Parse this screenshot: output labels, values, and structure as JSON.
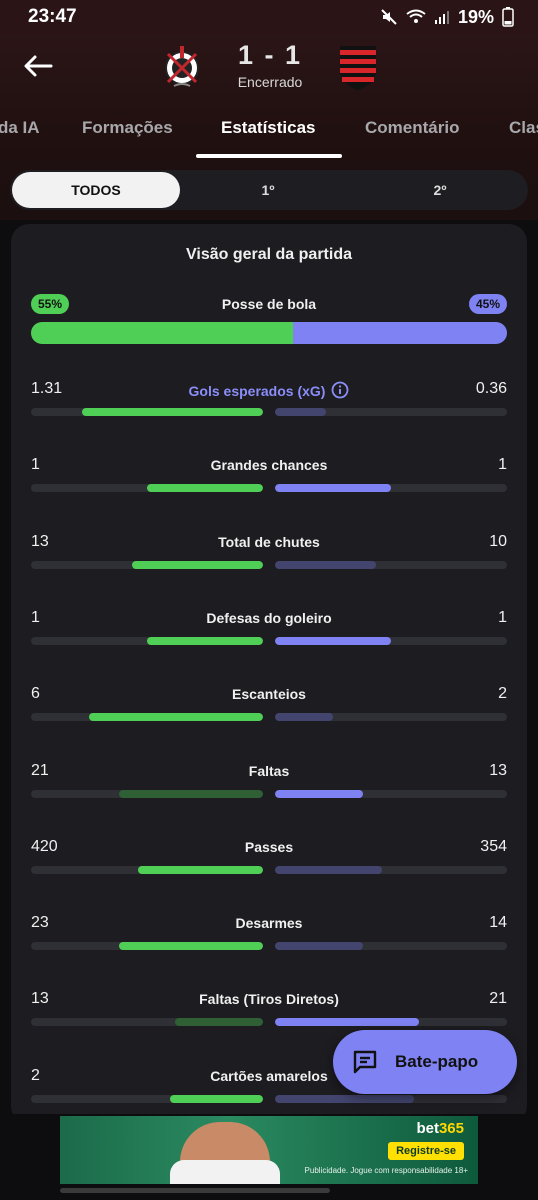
{
  "status_bar": {
    "time": "23:47",
    "battery": "19%"
  },
  "match": {
    "home_score": "1",
    "separator": "-",
    "away_score": "1",
    "status": "Encerrado"
  },
  "tabs": [
    {
      "label": "da IA",
      "active": false
    },
    {
      "label": "Formações",
      "active": false
    },
    {
      "label": "Estatísticas",
      "active": true
    },
    {
      "label": "Comentário",
      "active": false
    },
    {
      "label": "Clas",
      "active": false
    }
  ],
  "periods": [
    {
      "label": "TODOS",
      "active": true
    },
    {
      "label": "1º",
      "active": false
    },
    {
      "label": "2º",
      "active": false
    }
  ],
  "card": {
    "title": "Visão geral da partida"
  },
  "possession": {
    "label": "Posse de bola",
    "home": "55%",
    "away": "45%",
    "home_fraction": 0.55
  },
  "stats": [
    {
      "label": "Gols esperados (xG)",
      "home": "1.31",
      "away": "0.36",
      "home_frac": 0.78,
      "away_frac": 0.22,
      "winner": "home",
      "link": true
    },
    {
      "label": "Grandes chances",
      "home": "1",
      "away": "1",
      "home_frac": 0.5,
      "away_frac": 0.5,
      "winner": "both"
    },
    {
      "label": "Total de chutes",
      "home": "13",
      "away": "10",
      "home_frac": 0.565,
      "away_frac": 0.435,
      "winner": "home"
    },
    {
      "label": "Defesas do goleiro",
      "home": "1",
      "away": "1",
      "home_frac": 0.5,
      "away_frac": 0.5,
      "winner": "both"
    },
    {
      "label": "Escanteios",
      "home": "6",
      "away": "2",
      "home_frac": 0.75,
      "away_frac": 0.25,
      "winner": "home"
    },
    {
      "label": "Faltas",
      "home": "21",
      "away": "13",
      "home_frac": 0.62,
      "away_frac": 0.38,
      "winner": "away"
    },
    {
      "label": "Passes",
      "home": "420",
      "away": "354",
      "home_frac": 0.54,
      "away_frac": 0.46,
      "winner": "home"
    },
    {
      "label": "Desarmes",
      "home": "23",
      "away": "14",
      "home_frac": 0.62,
      "away_frac": 0.38,
      "winner": "home"
    },
    {
      "label": "Faltas (Tiros Diretos)",
      "home": "13",
      "away": "21",
      "home_frac": 0.38,
      "away_frac": 0.62,
      "winner": "away"
    },
    {
      "label": "Cartões amarelos",
      "home": "2",
      "away": "3",
      "home_frac": 0.4,
      "away_frac": 0.6,
      "winner": "home"
    }
  ],
  "chat_button": {
    "label": "Bate-papo"
  },
  "ad": {
    "brand_main": "bet",
    "brand_accent": "365",
    "cta": "Registre-se",
    "fine_print": "Publicidade. Jogue com responsabilidade 18+"
  },
  "colors": {
    "home": "#4fcf55",
    "away": "#7f82f2",
    "home_dim": "#2f5f35",
    "away_dim": "#43456f"
  }
}
